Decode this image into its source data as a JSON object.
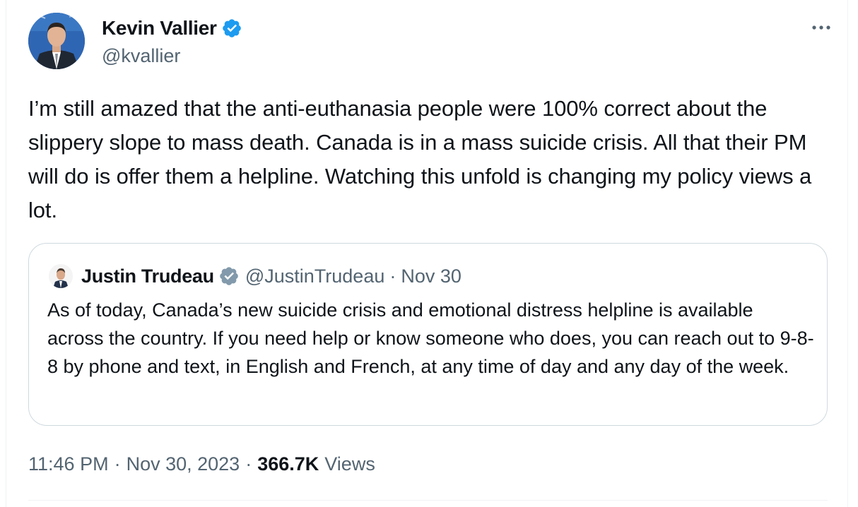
{
  "author": {
    "display_name": "Kevin Vallier",
    "handle": "@kvallier",
    "verified_icon": "verified-badge-blue",
    "verified_color": "#1d9bf0"
  },
  "tweet": {
    "text": "I’m still amazed that the anti-euthanasia people were 100% correct about the slippery slope to mass death. Canada is in a mass suicide crisis. All that their PM will do is offer them a helpline. Watching this unfold is changing my policy views a lot."
  },
  "quoted_tweet": {
    "display_name": "Justin Trudeau",
    "verified_icon": "verified-badge-gray",
    "verified_color": "#829aab",
    "handle": "@JustinTrudeau",
    "separator": "·",
    "date": "Nov 30",
    "text": "As of today, Canada’s new suicide crisis and emotional distress helpline is available across the country. If you need help or know someone who does, you can reach out to 9-8-8 by phone and text, in English and French, at any time of day and any day of the week."
  },
  "footer": {
    "time": "11:46 PM",
    "separator": "·",
    "date": "Nov 30, 2023",
    "views_count": "366.7K",
    "views_label": "Views"
  },
  "menu": {
    "more_icon": "more-horizontal-icon"
  }
}
